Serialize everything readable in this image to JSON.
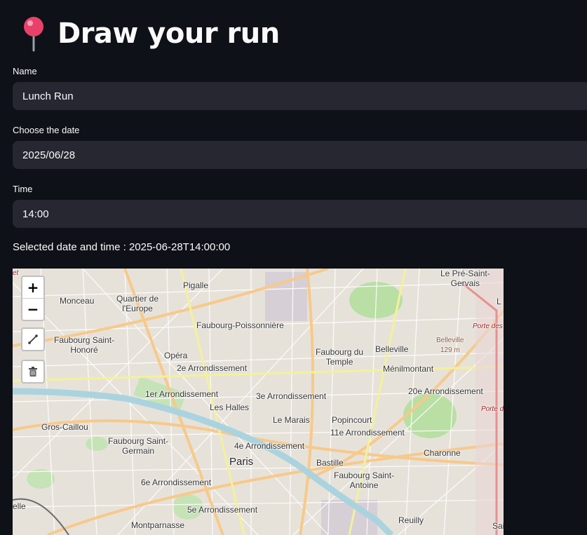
{
  "header": {
    "title": "Draw your run",
    "icon": "map-pin-icon"
  },
  "form": {
    "name_label": "Name",
    "name_value": "Lunch Run",
    "date_label": "Choose the date",
    "date_value": "2025/06/28",
    "time_label": "Time",
    "time_value": "14:00",
    "selected_text": "Selected date and time : 2025-06-28T14:00:00"
  },
  "map": {
    "zoom_in_label": "+",
    "zoom_out_label": "−",
    "labels": {
      "pigalle": "Pigalle",
      "monceau": "Monceau",
      "quartier_europe": "Quartier de\nl'Europe",
      "pre_saint_gervais": "Le Pré-Saint-\nGervais",
      "faubourg_poissonniere": "Faubourg-Poissonnière",
      "faubourg_saint_honore": "Faubourg Saint-\nHonoré",
      "opera": "Opéra",
      "faubourg_du_temple": "Faubourg du\nTemple",
      "belleville": "Belleville",
      "belleville_peak": "Belleville\n129 m",
      "porte_des": "Porte des",
      "arr_2": "2e Arrondissement",
      "menilmontant": "Ménilmontant",
      "arr_1": "1er Arrondissement",
      "arr_3": "3e Arrondissement",
      "arr_20": "20e Arrondissement",
      "les_halles": "Les Halles",
      "porte_de": "Porte de",
      "gros_caillou": "Gros-Caillou",
      "le_marais": "Le Marais",
      "popincourt": "Popincourt",
      "arr_11": "11e Arrondissement",
      "faubourg_saint_germain": "Faubourg Saint-\nGermain",
      "arr_4": "4e Arrondissement",
      "charonne": "Charonne",
      "paris": "Paris",
      "bastille": "Bastille",
      "faubourg_saint_antoine": "Faubourg Saint-\nAntoine",
      "arr_6": "6e Arrondissement",
      "arr_5": "5e Arrondissement",
      "montparnasse": "Montparnasse",
      "reuilly": "Reuilly",
      "edge_left_top": "et",
      "edge_left_bottom": "elle",
      "edge_right_top": "L",
      "edge_right_bottom": "Sai"
    }
  }
}
